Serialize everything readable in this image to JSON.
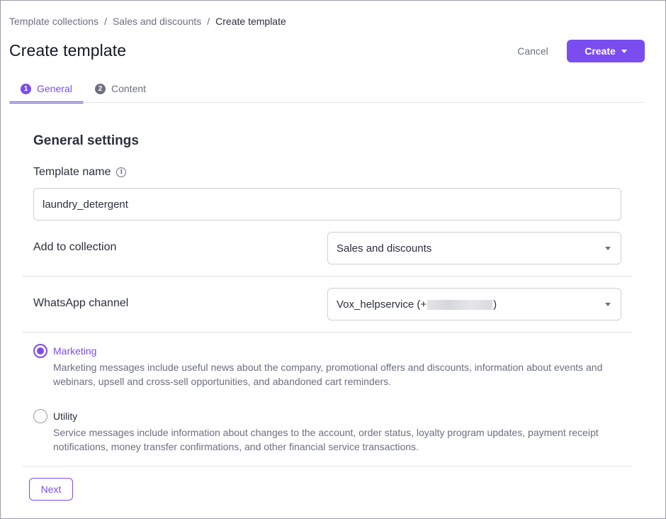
{
  "breadcrumb": {
    "items": [
      "Template collections",
      "Sales and discounts"
    ],
    "current": "Create template",
    "separator": "/"
  },
  "header": {
    "title": "Create template",
    "cancel_label": "Cancel",
    "create_label": "Create"
  },
  "tabs": [
    {
      "number": "1",
      "label": "General",
      "active": true
    },
    {
      "number": "2",
      "label": "Content",
      "active": false
    }
  ],
  "form": {
    "section_title": "General settings",
    "template_name_label": "Template name",
    "template_name_value": "laundry_detergent",
    "collection_label": "Add to collection",
    "collection_value": "Sales and discounts",
    "channel_label": "WhatsApp channel",
    "channel_value_prefix": "Vox_helpservice (+",
    "channel_value_suffix": ")"
  },
  "categories": [
    {
      "label": "Marketing",
      "checked": true,
      "description": "Marketing messages include useful news about the company, promotional offers and discounts, information about events and webinars, upsell and cross-sell opportunities, and abandoned cart reminders."
    },
    {
      "label": "Utility",
      "checked": false,
      "description": "Service messages include information about changes to the account, order status, loyalty program updates, payment receipt notifications, money transfer confirmations, and other financial service transactions."
    }
  ],
  "footer": {
    "next_label": "Next"
  },
  "colors": {
    "accent": "#7b4cf0",
    "muted": "#6b6f80",
    "border": "#cfd1da"
  },
  "icons": {
    "info": "info-icon",
    "dropdown": "chevron-down-icon"
  }
}
